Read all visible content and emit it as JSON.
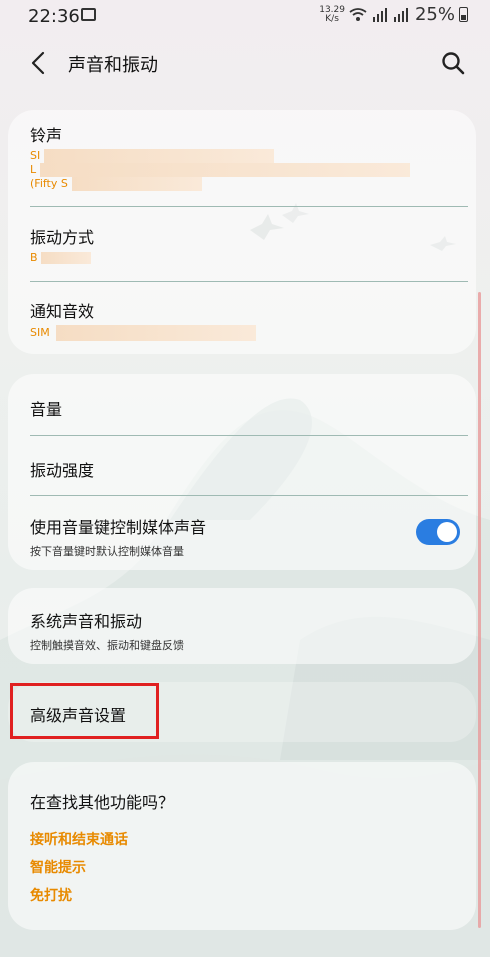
{
  "status_bar": {
    "time": "22:36",
    "net_speed_value": "13.29",
    "net_speed_unit": "K/s",
    "battery": "25%"
  },
  "header": {
    "title": "声音和振动"
  },
  "sound_card": {
    "ringtone": {
      "label": "铃声",
      "sub_line1": "SI",
      "sub_line2": "L",
      "sub_line3": "(Fifty S"
    },
    "vibration_pattern": {
      "label": "振动方式",
      "sub": "B"
    },
    "notification_sound": {
      "label": "通知音效",
      "sub": "SIM"
    }
  },
  "volume_card": {
    "volume": {
      "label": "音量"
    },
    "vibration_intensity": {
      "label": "振动强度"
    },
    "media_key": {
      "label": "使用音量键控制媒体声音",
      "desc": "按下音量键时默认控制媒体音量",
      "enabled": true
    }
  },
  "system_card": {
    "label": "系统声音和振动",
    "desc": "控制触摸音效、振动和键盘反馈"
  },
  "advanced": {
    "label": "高级声音设置"
  },
  "suggestions": {
    "heading": "在查找其他功能吗？",
    "links": [
      "接听和结束通话",
      "智能提示",
      "免打扰"
    ]
  },
  "colors": {
    "accent_orange": "#e88a00",
    "toggle_blue": "#2a7de1",
    "highlight_red": "#e02020"
  }
}
